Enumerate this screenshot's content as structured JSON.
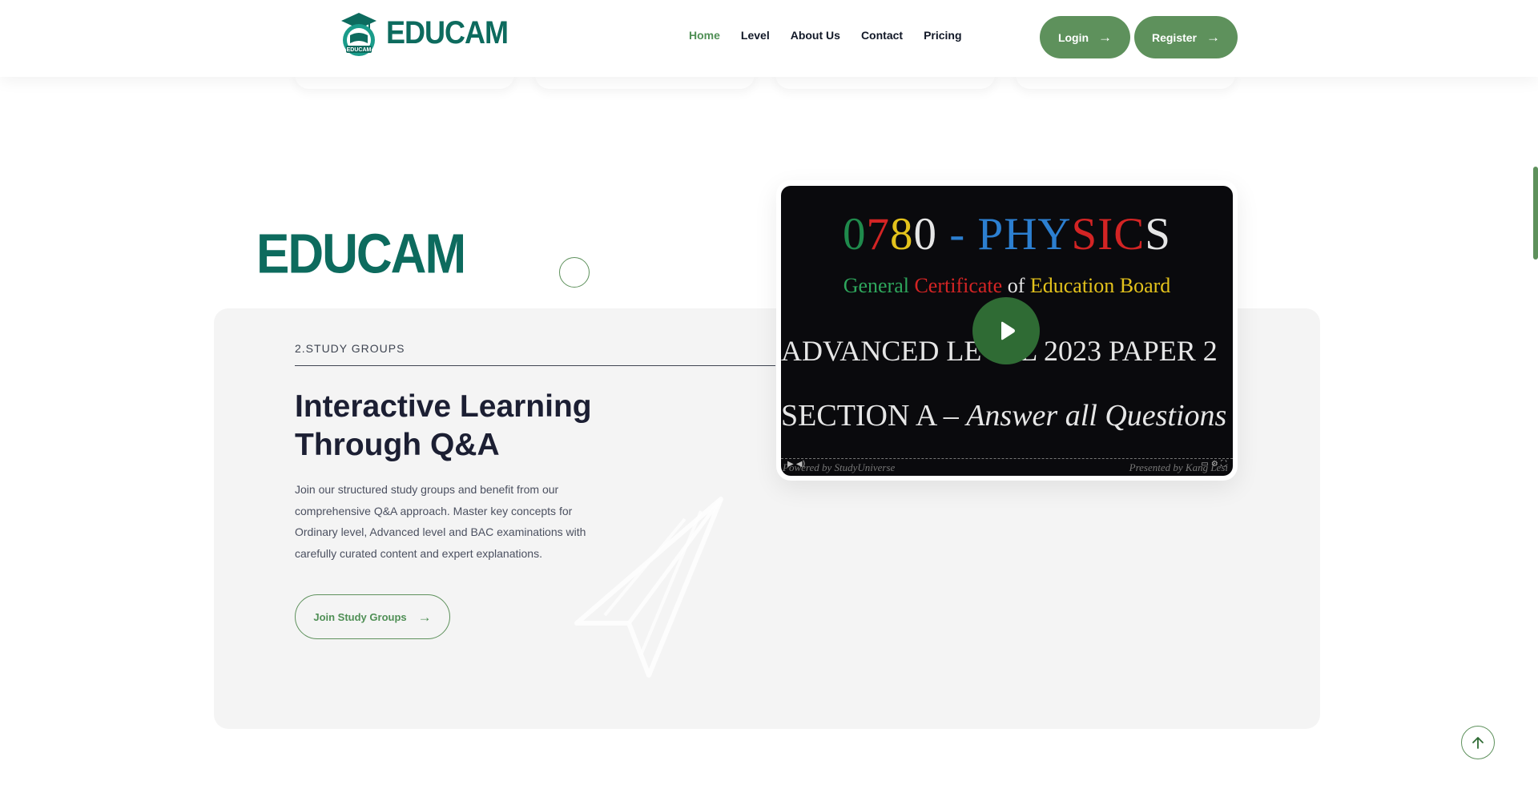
{
  "header": {
    "logo_text": "EDUCAM",
    "logo_badge_text": "EDUCAM",
    "nav": [
      {
        "label": "Home",
        "active": true
      },
      {
        "label": "Level"
      },
      {
        "label": "About Us"
      },
      {
        "label": "Contact"
      },
      {
        "label": "Pricing"
      }
    ],
    "login_label": "Login",
    "register_label": "Register"
  },
  "section": {
    "brand_text": "EDUCAM",
    "eyebrow": "2.STUDY GROUPS",
    "headline": "Interactive Learning Through Q&A",
    "body": "Join our structured study groups and benefit from our comprehensive Q&A approach. Master key concepts for Ordinary level, Advanced level and BAC examinations with carefully curated content and expert explanations.",
    "cta_label": "Join Study Groups"
  },
  "video": {
    "title_parts": [
      {
        "text": "0",
        "color": "#1f8a4c"
      },
      {
        "text": "7",
        "color": "#d32424"
      },
      {
        "text": "8",
        "color": "#e3c21c"
      },
      {
        "text": "0",
        "color": "#e6e6e6"
      },
      {
        "text": " - ",
        "color": "#2c7fd0"
      },
      {
        "text": "PHY",
        "color": "#2c7fd0"
      },
      {
        "text": "SIC",
        "color": "#d32424"
      },
      {
        "text": "S",
        "color": "#e6e6e6"
      }
    ],
    "subtitle_parts": [
      {
        "text": "General ",
        "color": "#2ea65c"
      },
      {
        "text": "Certificate ",
        "color": "#d32424"
      },
      {
        "text": "of ",
        "color": "#e6e6e6"
      },
      {
        "text": "Education Board",
        "color": "#e3c21c"
      }
    ],
    "line1": "ADVANCED LEVEL 2023 PAPER 2",
    "line2_plain": "SECTION A – ",
    "line2_italic": "Answer all Questions",
    "footer_left": "Powered by StudyUniverse",
    "footer_right": "Presented by Kang Lesi"
  },
  "colors": {
    "brand_green": "#0d6b5e",
    "accent_green": "#5e915c",
    "panel_bg": "#f4f4f4"
  },
  "icons": [
    "arrow-right-icon",
    "play-icon",
    "arrow-up-icon",
    "graduation-cap-icon",
    "paper-plane-icon"
  ]
}
